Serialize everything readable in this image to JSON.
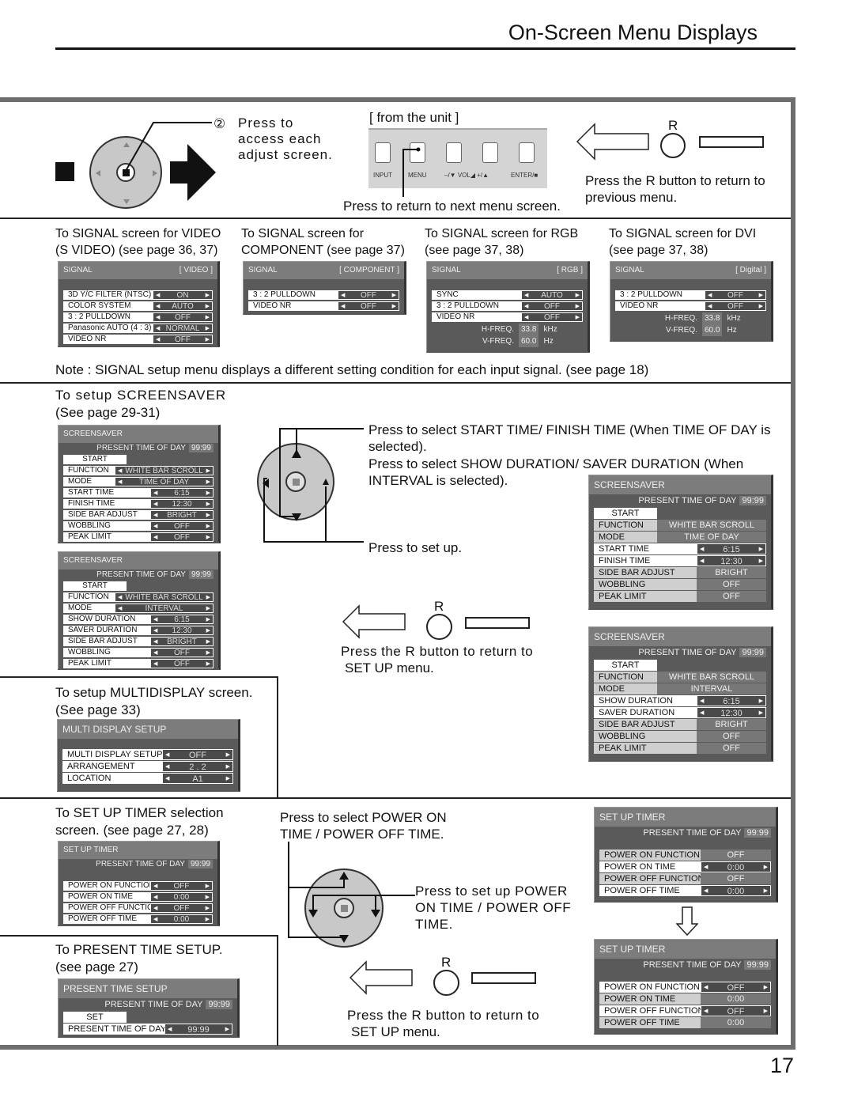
{
  "header": {
    "title": "On-Screen Menu Displays"
  },
  "page_number": "17",
  "top": {
    "step_marker": "②",
    "press_access": "Press to access each adjust screen.",
    "from_unit": "[ from the unit ]",
    "unit_keys": [
      "INPUT",
      "MENU",
      "–/▼ VOL◢ +/▲",
      "ENTER/■"
    ],
    "press_return_next": "Press to return to next menu screen.",
    "r_label": "R",
    "press_r_previous": "Press the R button to return to previous menu."
  },
  "signal_section": {
    "captions": [
      "To SIGNAL screen for VIDEO (S VIDEO) (see page 36, 37)",
      "To SIGNAL screen for COMPONENT (see page 37)",
      "To SIGNAL screen for RGB (see page 37, 38)",
      "To SIGNAL screen for DVI (see page 37, 38)"
    ],
    "menus": [
      {
        "title": "SIGNAL",
        "tag": "[ VIDEO ]",
        "rows": [
          {
            "label": "3D Y/C FILTER (NTSC)",
            "value": "ON"
          },
          {
            "label": "COLOR SYSTEM",
            "value": "AUTO"
          },
          {
            "label": "3 : 2 PULLDOWN",
            "value": "OFF"
          },
          {
            "label": "Panasonic AUTO (4 : 3)",
            "value": "NORMAL"
          },
          {
            "label": "VIDEO NR",
            "value": "OFF"
          }
        ]
      },
      {
        "title": "SIGNAL",
        "tag": "[ COMPONENT ]",
        "rows": [
          {
            "label": "3 : 2 PULLDOWN",
            "value": "OFF"
          },
          {
            "label": "VIDEO NR",
            "value": "OFF"
          }
        ]
      },
      {
        "title": "SIGNAL",
        "tag": "[ RGB ]",
        "rows": [
          {
            "label": "SYNC",
            "value": "AUTO"
          },
          {
            "label": "3 : 2 PULLDOWN",
            "value": "OFF"
          },
          {
            "label": "VIDEO NR",
            "value": "OFF"
          }
        ],
        "freq": [
          {
            "label": "H-FREQ.",
            "value": "33.8",
            "unit": "kHz"
          },
          {
            "label": "V-FREQ.",
            "value": "60.0",
            "unit": "Hz"
          }
        ]
      },
      {
        "title": "SIGNAL",
        "tag": "[ Digital ]",
        "rows": [
          {
            "label": "3 : 2 PULLDOWN",
            "value": "OFF"
          },
          {
            "label": "VIDEO NR",
            "value": "OFF"
          }
        ],
        "freq": [
          {
            "label": "H-FREQ.",
            "value": "33.8",
            "unit": "kHz"
          },
          {
            "label": "V-FREQ.",
            "value": "60.0",
            "unit": "Hz"
          }
        ]
      }
    ],
    "note": "Note :   SIGNAL  setup menu displays a different setting condition for each input signal. (see page 18)"
  },
  "screensaver_section": {
    "caption_line1": "To  setup  SCREENSAVER",
    "caption_line2": "(See page 29-31)",
    "press_select_1": "Press to select START TIME/ FINISH TIME (When TIME OF DAY is selected).",
    "press_select_2": "Press  to  select  SHOW  DURATION/  SAVER  DURATION  (When INTERVAL is selected).",
    "press_set_up": "Press to set up.",
    "r_label": "R",
    "press_r_setup": "Press  the  R  button  to  return  to",
    "press_r_setup2": "SET UP  menu.",
    "menus": [
      {
        "title": "SCREENSAVER",
        "present_label": "PRESENT  TIME OF DAY",
        "present_value": "99:99",
        "start": "START",
        "rows": [
          {
            "label": "FUNCTION",
            "value": "WHITE BAR SCROLL"
          },
          {
            "label": "MODE",
            "value": "TIME OF DAY"
          },
          {
            "label": "START TIME",
            "value": "6:15"
          },
          {
            "label": "FINISH TIME",
            "value": "12:30"
          },
          {
            "label": "SIDE BAR ADJUST",
            "value": "BRIGHT"
          },
          {
            "label": "WOBBLING",
            "value": "OFF"
          },
          {
            "label": "PEAK LIMIT",
            "value": "OFF"
          }
        ]
      },
      {
        "title": "SCREENSAVER",
        "present_label": "PRESENT  TIME OF DAY",
        "present_value": "99:99",
        "start": "START",
        "rows": [
          {
            "label": "FUNCTION",
            "value": "WHITE BAR SCROLL"
          },
          {
            "label": "MODE",
            "value": "INTERVAL"
          },
          {
            "label": "SHOW DURATION",
            "value": "6:15"
          },
          {
            "label": "SAVER DURATION",
            "value": "12:30"
          },
          {
            "label": "SIDE BAR ADJUST",
            "value": "BRIGHT"
          },
          {
            "label": "WOBBLING",
            "value": "OFF"
          },
          {
            "label": "PEAK LIMIT",
            "value": "OFF"
          }
        ]
      },
      {
        "title": "SCREENSAVER",
        "present_label": "PRESENT  TIME OF DAY",
        "present_value": "99:99",
        "start": "START",
        "rows": [
          {
            "label": "FUNCTION",
            "value": "WHITE BAR SCROLL",
            "active": false
          },
          {
            "label": "MODE",
            "value": "TIME OF DAY",
            "active": false
          },
          {
            "label": "START TIME",
            "value": "6:15",
            "active": true
          },
          {
            "label": "FINISH TIME",
            "value": "12:30",
            "active": true
          },
          {
            "label": "SIDE BAR ADJUST",
            "value": "BRIGHT",
            "active": false
          },
          {
            "label": "WOBBLING",
            "value": "OFF",
            "active": false
          },
          {
            "label": "PEAK LIMIT",
            "value": "OFF",
            "active": false
          }
        ]
      },
      {
        "title": "SCREENSAVER",
        "present_label": "PRESENT  TIME OF DAY",
        "present_value": "99:99",
        "start": "START",
        "rows": [
          {
            "label": "FUNCTION",
            "value": "WHITE BAR SCROLL",
            "active": false
          },
          {
            "label": "MODE",
            "value": "INTERVAL",
            "active": false
          },
          {
            "label": "SHOW DURATION",
            "value": "6:15",
            "active": true
          },
          {
            "label": "SAVER DURATION",
            "value": "12:30",
            "active": true
          },
          {
            "label": "SIDE BAR ADJUST",
            "value": "BRIGHT",
            "active": false
          },
          {
            "label": "WOBBLING",
            "value": "OFF",
            "active": false
          },
          {
            "label": "PEAK LIMIT",
            "value": "OFF",
            "active": false
          }
        ]
      }
    ]
  },
  "multidisplay_section": {
    "caption_line1": "To setup MULTIDISPLAY screen.",
    "caption_line2": "(See page 33)",
    "menu": {
      "title": "MULTI DISPLAY SETUP",
      "rows": [
        {
          "label": "MULTI DISPLAY SETUP",
          "value": "OFF"
        },
        {
          "label": "ARRANGEMENT",
          "value": "2 . 2"
        },
        {
          "label": "LOCATION",
          "value": "A1"
        }
      ]
    }
  },
  "timer_section": {
    "caption_line1": "To SET UP TIMER selection",
    "caption_line2": "screen. (see page 27, 28)",
    "press_select": "Press to select POWER ON TIME / POWER OFF TIME.",
    "press_set": "Press  to  set  up  POWER ON  TIME  /  POWER  OFF TIME.",
    "r_label": "R",
    "press_r_setup": "Press  the  R  button  to  return  to",
    "press_r_setup2": "SET UP  menu.",
    "menus": [
      {
        "title": "SET UP TIMER",
        "present_label": "PRESENT  TIME OF DAY",
        "present_value": "99:99",
        "rows": [
          {
            "label": "POWER ON FUNCTION",
            "value": "OFF"
          },
          {
            "label": "POWER ON TIME",
            "value": "0:00"
          },
          {
            "label": "POWER OFF FUNCTION",
            "value": "OFF"
          },
          {
            "label": "POWER OFF TIME",
            "value": "0:00"
          }
        ]
      },
      {
        "title": "SET UP TIMER",
        "present_label": "PRESENT  TIME OF DAY",
        "present_value": "99:99",
        "rows": [
          {
            "label": "POWER ON FUNCTION",
            "value": "OFF",
            "active": false
          },
          {
            "label": "POWER ON TIME",
            "value": "0:00",
            "active": true
          },
          {
            "label": "POWER OFF FUNCTION",
            "value": "OFF",
            "active": false
          },
          {
            "label": "POWER OFF TIME",
            "value": "0:00",
            "active": true
          }
        ]
      },
      {
        "title": "SET UP TIMER",
        "present_label": "PRESENT  TIME OF DAY",
        "present_value": "99:99",
        "rows": [
          {
            "label": "POWER ON FUNCTION",
            "value": "OFF",
            "active": true
          },
          {
            "label": "POWER ON TIME",
            "value": "0:00",
            "active": false
          },
          {
            "label": "POWER OFF FUNCTION",
            "value": "OFF",
            "active": true
          },
          {
            "label": "POWER OFF TIME",
            "value": "0:00",
            "active": false
          }
        ]
      }
    ]
  },
  "present_time_section": {
    "caption_line1": "To PRESENT TIME SETUP.",
    "caption_line2": "(see page 27)",
    "menu": {
      "title": "PRESENT  TIME SETUP",
      "present_label": "PRESENT  TIME OF DAY",
      "present_value": "99:99",
      "set": "SET",
      "rows": [
        {
          "label": "PRESENT  TIME OF DAY",
          "value": "99:99"
        }
      ]
    }
  }
}
